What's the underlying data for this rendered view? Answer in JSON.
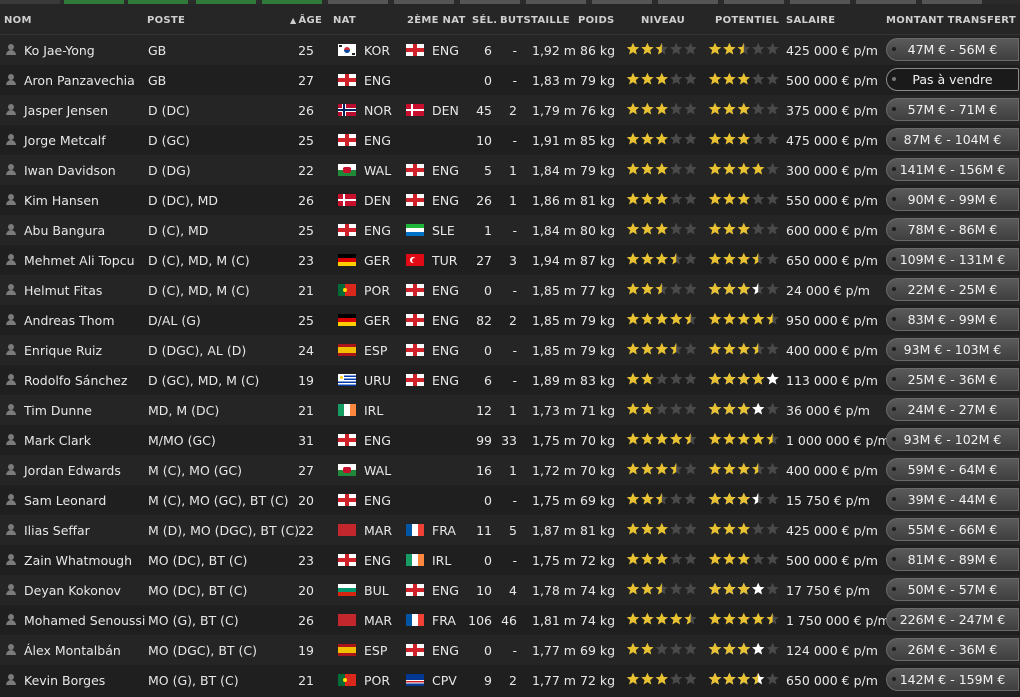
{
  "columns": {
    "name": "NOM",
    "position": "POSTE",
    "age": "ÂGE",
    "age_sort_icon": "sort-up-icon",
    "nat": "NAT",
    "nat2": "2ÈME NAT",
    "caps": "SÉL.",
    "goals": "BUTS",
    "height": "TAILLE",
    "weight": "POIDS",
    "ability": "NIVEAU",
    "potential": "POTENTIEL",
    "wage": "SALAIRE",
    "transfer": "MONTANT TRANSFERT"
  },
  "colors": {
    "star_filled": "#e9c231",
    "star_empty": "#4a4a4a",
    "star_potential_best": "#ffffff"
  },
  "players": [
    {
      "name": "Ko Jae-Yong",
      "position": "GB",
      "age": "25",
      "nat": "KOR",
      "nat2": "ENG",
      "caps": "6",
      "goals": "-",
      "height": "1,92 m",
      "weight": "86 kg",
      "ability": 2.5,
      "potential": 2.5,
      "potential_best": 0,
      "wage": "425 000 € p/m",
      "transfer": "47M € - 56M €"
    },
    {
      "name": "Aron Panzavechia",
      "position": "GB",
      "age": "27",
      "nat": "ENG",
      "nat2": "",
      "caps": "0",
      "goals": "-",
      "height": "1,83 m",
      "weight": "79 kg",
      "ability": 3,
      "potential": 3,
      "potential_best": 0,
      "wage": "500 000 € p/m",
      "transfer": "Pas à vendre"
    },
    {
      "name": "Jasper Jensen",
      "position": "D (DC)",
      "age": "26",
      "nat": "NOR",
      "nat2": "DEN",
      "caps": "45",
      "goals": "2",
      "height": "1,79 m",
      "weight": "76 kg",
      "ability": 3,
      "potential": 3,
      "potential_best": 0,
      "wage": "375 000 € p/m",
      "transfer": "57M € - 71M €"
    },
    {
      "name": "Jorge Metcalf",
      "position": "D (GC)",
      "age": "25",
      "nat": "ENG",
      "nat2": "",
      "caps": "10",
      "goals": "-",
      "height": "1,91 m",
      "weight": "85 kg",
      "ability": 3,
      "potential": 3,
      "potential_best": 0,
      "wage": "475 000 € p/m",
      "transfer": "87M € - 104M €"
    },
    {
      "name": "Iwan Davidson",
      "position": "D (DG)",
      "age": "22",
      "nat": "WAL",
      "nat2": "ENG",
      "caps": "5",
      "goals": "1",
      "height": "1,84 m",
      "weight": "79 kg",
      "ability": 3,
      "potential": 4,
      "potential_best": 0,
      "wage": "300 000 € p/m",
      "transfer": "141M € - 156M €"
    },
    {
      "name": "Kim Hansen",
      "position": "D (DC), MD",
      "age": "26",
      "nat": "DEN",
      "nat2": "ENG",
      "caps": "26",
      "goals": "1",
      "height": "1,86 m",
      "weight": "81 kg",
      "ability": 3,
      "potential": 3,
      "potential_best": 0,
      "wage": "550 000 € p/m",
      "transfer": "90M € - 99M €"
    },
    {
      "name": "Abu Bangura",
      "position": "D (C), MD",
      "age": "25",
      "nat": "ENG",
      "nat2": "SLE",
      "caps": "1",
      "goals": "-",
      "height": "1,84 m",
      "weight": "80 kg",
      "ability": 3,
      "potential": 3,
      "potential_best": 0,
      "wage": "600 000 € p/m",
      "transfer": "78M € - 86M €"
    },
    {
      "name": "Mehmet Ali Topcu",
      "position": "D (C), MD, M (C)",
      "age": "23",
      "nat": "GER",
      "nat2": "TUR",
      "caps": "27",
      "goals": "3",
      "height": "1,94 m",
      "weight": "87 kg",
      "ability": 3.5,
      "potential": 3.5,
      "potential_best": 0,
      "wage": "650 000 € p/m",
      "transfer": "109M € - 131M €"
    },
    {
      "name": "Helmut Fitas",
      "position": "D (C), MD, M (C)",
      "age": "21",
      "nat": "POR",
      "nat2": "ENG",
      "caps": "0",
      "goals": "-",
      "height": "1,85 m",
      "weight": "77 kg",
      "ability": 2.5,
      "potential": 3,
      "potential_best": 0.5,
      "wage": "24 000 € p/m",
      "transfer": "22M € - 25M €"
    },
    {
      "name": "Andreas Thom",
      "position": "D/AL (G)",
      "age": "25",
      "nat": "GER",
      "nat2": "ENG",
      "caps": "82",
      "goals": "2",
      "height": "1,85 m",
      "weight": "79 kg",
      "ability": 4.5,
      "potential": 4.5,
      "potential_best": 0,
      "wage": "950 000 € p/m",
      "transfer": "83M € - 99M €"
    },
    {
      "name": "Enrique Ruiz",
      "position": "D (DGC), AL (D)",
      "age": "24",
      "nat": "ESP",
      "nat2": "ENG",
      "caps": "0",
      "goals": "-",
      "height": "1,85 m",
      "weight": "79 kg",
      "ability": 3.5,
      "potential": 3.5,
      "potential_best": 0,
      "wage": "400 000 € p/m",
      "transfer": "93M € - 103M €"
    },
    {
      "name": "Rodolfo Sánchez",
      "position": "D (GC), MD, M (C)",
      "age": "19",
      "nat": "URU",
      "nat2": "ENG",
      "caps": "6",
      "goals": "-",
      "height": "1,89 m",
      "weight": "83 kg",
      "ability": 2,
      "potential": 4,
      "potential_best": 1,
      "wage": "113 000 € p/m",
      "transfer": "25M € - 36M €"
    },
    {
      "name": "Tim Dunne",
      "position": "MD, M (DC)",
      "age": "21",
      "nat": "IRL",
      "nat2": "",
      "caps": "12",
      "goals": "1",
      "height": "1,73 m",
      "weight": "71 kg",
      "ability": 2,
      "potential": 3,
      "potential_best": 1,
      "wage": "36 000 € p/m",
      "transfer": "24M € - 27M €"
    },
    {
      "name": "Mark Clark",
      "position": "M/MO (GC)",
      "age": "31",
      "nat": "ENG",
      "nat2": "",
      "caps": "99",
      "goals": "33",
      "height": "1,75 m",
      "weight": "70 kg",
      "ability": 4.5,
      "potential": 4.5,
      "potential_best": 0,
      "wage": "1 000 000 € p/m",
      "transfer": "93M € - 102M €"
    },
    {
      "name": "Jordan Edwards",
      "position": "M (C), MO (GC)",
      "age": "27",
      "nat": "WAL",
      "nat2": "",
      "caps": "16",
      "goals": "1",
      "height": "1,72 m",
      "weight": "70 kg",
      "ability": 3.5,
      "potential": 3.5,
      "potential_best": 0,
      "wage": "400 000 € p/m",
      "transfer": "59M € - 64M €"
    },
    {
      "name": "Sam Leonard",
      "position": "M (C), MO (GC), BT (C)",
      "age": "20",
      "nat": "ENG",
      "nat2": "",
      "caps": "0",
      "goals": "-",
      "height": "1,75 m",
      "weight": "69 kg",
      "ability": 2.5,
      "potential": 3,
      "potential_best": 0.5,
      "wage": "15 750 € p/m",
      "transfer": "39M € - 44M €"
    },
    {
      "name": "Ilias Seffar",
      "position": "M (D), MO (DGC), BT (C)",
      "age": "22",
      "nat": "MAR",
      "nat2": "FRA",
      "caps": "11",
      "goals": "5",
      "height": "1,87 m",
      "weight": "81 kg",
      "ability": 3,
      "potential": 3,
      "potential_best": 0,
      "wage": "425 000 € p/m",
      "transfer": "55M € - 66M €"
    },
    {
      "name": "Zain Whatmough",
      "position": "MO (DC), BT (C)",
      "age": "23",
      "nat": "ENG",
      "nat2": "IRL",
      "caps": "0",
      "goals": "-",
      "height": "1,75 m",
      "weight": "72 kg",
      "ability": 3,
      "potential": 3,
      "potential_best": 0,
      "wage": "500 000 € p/m",
      "transfer": "81M € - 89M €"
    },
    {
      "name": "Deyan Kokonov",
      "position": "MO (DC), BT (C)",
      "age": "20",
      "nat": "BUL",
      "nat2": "ENG",
      "caps": "10",
      "goals": "4",
      "height": "1,78 m",
      "weight": "74 kg",
      "ability": 2.5,
      "potential": 3,
      "potential_best": 1,
      "wage": "17 750 € p/m",
      "transfer": "50M € - 57M €"
    },
    {
      "name": "Mohamed Senoussi",
      "position": "MO (G), BT (C)",
      "age": "26",
      "nat": "MAR",
      "nat2": "FRA",
      "caps": "106",
      "goals": "46",
      "height": "1,81 m",
      "weight": "74 kg",
      "ability": 4.5,
      "potential": 4.5,
      "potential_best": 0,
      "wage": "1 750 000 € p/m",
      "transfer": "226M € - 247M €"
    },
    {
      "name": "Álex Montalbán",
      "position": "MO (DGC), BT (C)",
      "age": "19",
      "nat": "ESP",
      "nat2": "ENG",
      "caps": "0",
      "goals": "-",
      "height": "1,77 m",
      "weight": "69 kg",
      "ability": 2,
      "potential": 3,
      "potential_best": 1,
      "wage": "124 000 € p/m",
      "transfer": "26M € - 36M €"
    },
    {
      "name": "Kevin Borges",
      "position": "MO (G), BT (C)",
      "age": "21",
      "nat": "POR",
      "nat2": "CPV",
      "caps": "9",
      "goals": "2",
      "height": "1,77 m",
      "weight": "72 kg",
      "ability": 3,
      "potential": 3.5,
      "potential_best": 0.5,
      "wage": "650 000 € p/m",
      "transfer": "142M € - 159M €"
    }
  ]
}
